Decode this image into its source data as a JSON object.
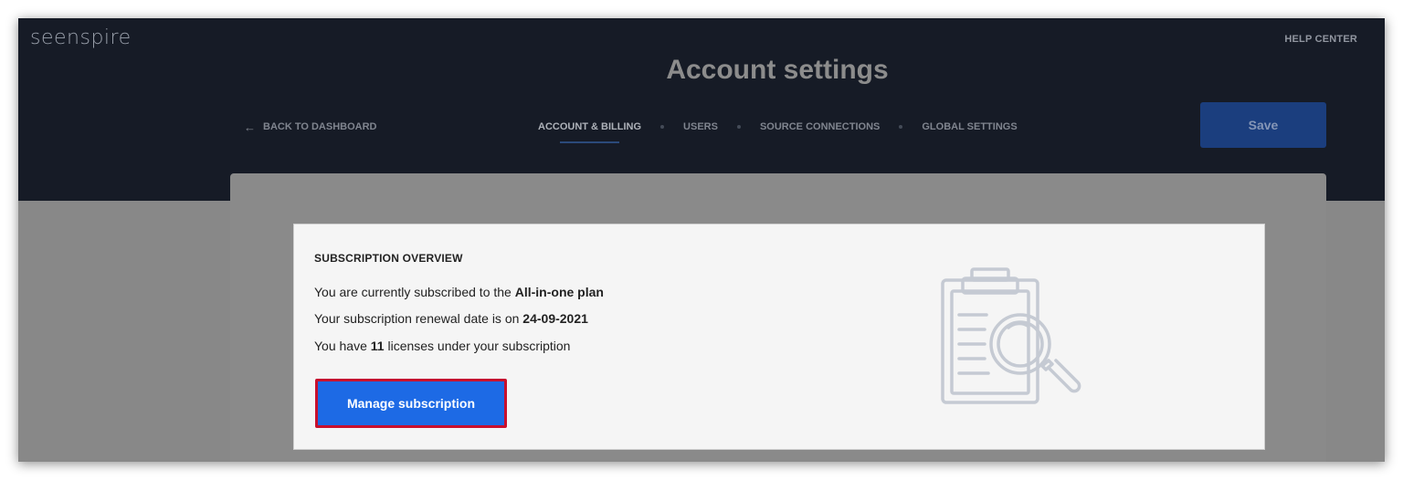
{
  "brand": {
    "logo_text": "seenspire"
  },
  "header": {
    "help_label": "HELP CENTER",
    "title": "Account settings",
    "back_label": "BACK TO DASHBOARD",
    "tabs": [
      {
        "label": "ACCOUNT & BILLING",
        "active": true
      },
      {
        "label": "USERS",
        "active": false
      },
      {
        "label": "SOURCE CONNECTIONS",
        "active": false
      },
      {
        "label": "GLOBAL SETTINGS",
        "active": false
      }
    ],
    "save_label": "Save"
  },
  "subscription": {
    "heading": "SUBSCRIPTION OVERVIEW",
    "plan_prefix": "You are currently subscribed to the ",
    "plan_name": "All-in-one plan",
    "renewal_prefix": "Your subscription renewal date is on ",
    "renewal_date": "24-09-2021",
    "licenses_prefix": "You have ",
    "licenses_count": "11",
    "licenses_suffix": " licenses under your subscription",
    "manage_label": "Manage subscription"
  },
  "icons": {
    "back": "arrow-left-icon",
    "illustration": "clipboard-search-icon"
  },
  "colors": {
    "header_bg": "#161b26",
    "primary_button": "#1d6ae5",
    "save_button": "#1b3e7e",
    "highlight_border": "#c8102e"
  }
}
